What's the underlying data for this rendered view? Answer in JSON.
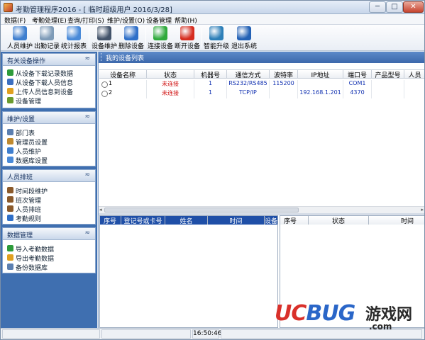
{
  "window": {
    "title": "考勤管理程序2016 - [ 临时超级用户 2016/3/28]",
    "minimize": "─",
    "maximize": "□",
    "close": "✕"
  },
  "menu": [
    "数据(F)",
    "考勤处理(E)",
    "查询/打印(S)",
    "维护/设置(O)",
    "设备管理",
    "帮助(H)"
  ],
  "toolbar": [
    {
      "label": "人员维护",
      "icon": "users-icon",
      "color": "#3f7fcf"
    },
    {
      "label": "出勤记录",
      "icon": "clock-icon",
      "color": "#7e9bb8"
    },
    {
      "label": "统计报表",
      "icon": "report-icon",
      "color": "#4a8ad8"
    },
    {
      "label": "设备维护",
      "icon": "device-icon",
      "color": "#43536a"
    },
    {
      "label": "删除设备",
      "icon": "delete-icon",
      "color": "#2f6fc8"
    },
    {
      "label": "连接设备",
      "icon": "connect-icon",
      "color": "#2faa3c"
    },
    {
      "label": "断开设备",
      "icon": "disconnect-icon",
      "color": "#d62c1f"
    },
    {
      "label": "智能升级",
      "icon": "globe-icon",
      "color": "#2d7fb8"
    },
    {
      "label": "退出系统",
      "icon": "power-icon",
      "color": "#2361b5"
    }
  ],
  "sidebar": {
    "sections": [
      {
        "title": "有关设备操作",
        "chevron": "≈",
        "items": [
          {
            "label": "从设备下载记录数据",
            "icon": "download-icon",
            "color": "#2d9b3a"
          },
          {
            "label": "从设备下载人员信息",
            "icon": "download-user-icon",
            "color": "#3c6fc0"
          },
          {
            "label": "上传人员信息到设备",
            "icon": "upload-icon",
            "color": "#e0a020"
          },
          {
            "label": "设备管理",
            "icon": "device-manage-icon",
            "color": "#6a9b2f"
          }
        ]
      },
      {
        "title": "维护/设置",
        "chevron": "≈",
        "items": [
          {
            "label": "部门表",
            "icon": "department-icon",
            "color": "#5b7fb0"
          },
          {
            "label": "管理员设置",
            "icon": "admin-icon",
            "color": "#c08a2f"
          },
          {
            "label": "人员维护",
            "icon": "person-icon",
            "color": "#3f7fcf"
          },
          {
            "label": "数据库设置",
            "icon": "database-icon",
            "color": "#4a8ad8"
          }
        ]
      },
      {
        "title": "人员排班",
        "chevron": "≈",
        "items": [
          {
            "label": "时间段维护",
            "icon": "time-period-icon",
            "color": "#8b5a2b"
          },
          {
            "label": "班次管理",
            "icon": "shift-icon",
            "color": "#8b5a2b"
          },
          {
            "label": "人员排班",
            "icon": "schedule-icon",
            "color": "#8b5a2b"
          },
          {
            "label": "考勤规则",
            "icon": "rule-icon",
            "color": "#2f6fc8"
          }
        ]
      },
      {
        "title": "数据管理",
        "chevron": "≈",
        "items": [
          {
            "label": "导入考勤数据",
            "icon": "import-icon",
            "color": "#2d9b3a"
          },
          {
            "label": "导出考勤数据",
            "icon": "export-icon",
            "color": "#e0a020"
          },
          {
            "label": "备份数据库",
            "icon": "backup-icon",
            "color": "#5b7fb0"
          }
        ]
      }
    ]
  },
  "device_list": {
    "title": "我的设备列表",
    "columns": [
      "设备名称",
      "状态",
      "机器号",
      "通信方式",
      "波特率",
      "IP地址",
      "端口号",
      "产品型号",
      "人员"
    ],
    "rows": [
      {
        "name": "1",
        "status": "未连接",
        "machine": "1",
        "comm": "RS232/RS485",
        "baud": "115200",
        "ip": "",
        "port": "COM1",
        "model": "",
        "people": ""
      },
      {
        "name": "2",
        "status": "未连接",
        "machine": "1",
        "comm": "TCP/IP",
        "baud": "",
        "ip": "192.168.1.201",
        "port": "4370",
        "model": "",
        "people": ""
      }
    ]
  },
  "records_grid": {
    "columns": [
      "序号",
      "登记号或卡号",
      "姓名",
      "时间",
      "设备"
    ]
  },
  "log_grid": {
    "columns": [
      "序号",
      "状态",
      "时间"
    ]
  },
  "status_bar": {
    "time": "16:50:46"
  },
  "watermark": {
    "brand": "UCBUG",
    "chinese": "游戏网",
    "domain": ".com"
  }
}
